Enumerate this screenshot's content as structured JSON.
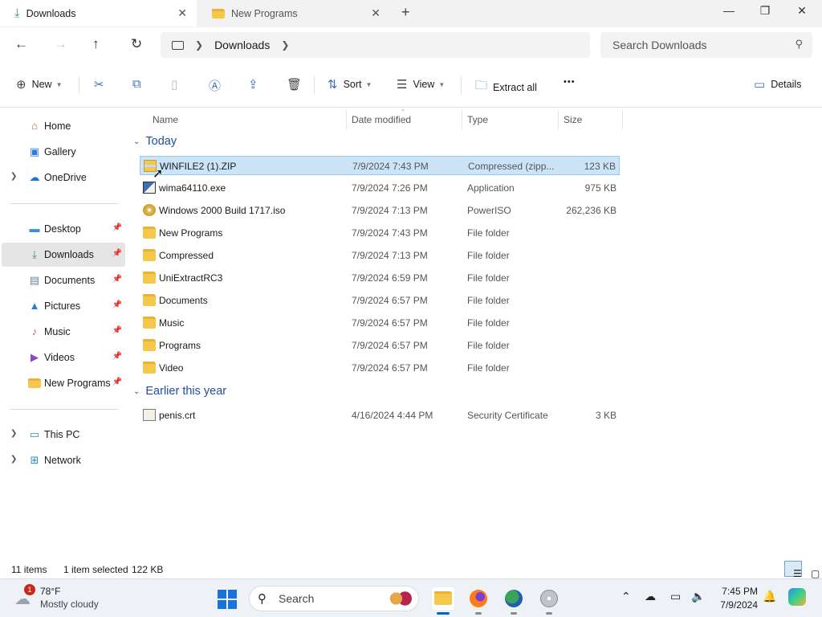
{
  "tabs": [
    {
      "label": "Downloads",
      "active": true
    },
    {
      "label": "New Programs",
      "active": false
    }
  ],
  "window_controls": {
    "minimize": "—",
    "maximize": "❐",
    "close": "✕",
    "new_tab": "+"
  },
  "address": {
    "segments": [
      "Downloads"
    ],
    "search_placeholder": "Search Downloads"
  },
  "commands": {
    "new": "New",
    "sort": "Sort",
    "view": "View",
    "extract_all": "Extract all",
    "more": "•••",
    "details": "Details"
  },
  "sidebar": {
    "top": [
      {
        "label": "Home",
        "icon": "home-icon",
        "expandable": false
      },
      {
        "label": "Gallery",
        "icon": "gallery-icon",
        "expandable": false
      },
      {
        "label": "OneDrive",
        "icon": "onedrive-icon",
        "expandable": true
      }
    ],
    "pinned": [
      {
        "label": "Desktop",
        "icon": "desktop-icon"
      },
      {
        "label": "Downloads",
        "icon": "downloads-icon",
        "selected": true
      },
      {
        "label": "Documents",
        "icon": "documents-icon"
      },
      {
        "label": "Pictures",
        "icon": "pictures-icon"
      },
      {
        "label": "Music",
        "icon": "music-icon"
      },
      {
        "label": "Videos",
        "icon": "videos-icon"
      },
      {
        "label": "New Programs",
        "icon": "folder-icon"
      }
    ],
    "bottom": [
      {
        "label": "This PC",
        "icon": "this-pc-icon"
      },
      {
        "label": "Network",
        "icon": "network-icon"
      }
    ]
  },
  "columns": {
    "name": "Name",
    "date": "Date modified",
    "type": "Type",
    "size": "Size"
  },
  "groups": [
    {
      "label": "Today",
      "files": [
        {
          "name": "WINFILE2 (1).ZIP",
          "date": "7/9/2024 7:43 PM",
          "type": "Compressed (zipp...",
          "size": "123 KB",
          "icon": "zip-icon",
          "selected": true
        },
        {
          "name": "wima64110.exe",
          "date": "7/9/2024 7:26 PM",
          "type": "Application",
          "size": "975 KB",
          "icon": "exe-icon"
        },
        {
          "name": "Windows 2000 Build 1717.iso",
          "date": "7/9/2024 7:13 PM",
          "type": "PowerISO",
          "size": "262,236 KB",
          "icon": "iso-icon"
        },
        {
          "name": "New Programs",
          "date": "7/9/2024 7:43 PM",
          "type": "File folder",
          "size": "",
          "icon": "folder-icon"
        },
        {
          "name": "Compressed",
          "date": "7/9/2024 7:13 PM",
          "type": "File folder",
          "size": "",
          "icon": "folder-icon"
        },
        {
          "name": "UniExtractRC3",
          "date": "7/9/2024 6:59 PM",
          "type": "File folder",
          "size": "",
          "icon": "folder-icon"
        },
        {
          "name": "Documents",
          "date": "7/9/2024 6:57 PM",
          "type": "File folder",
          "size": "",
          "icon": "folder-icon"
        },
        {
          "name": "Music",
          "date": "7/9/2024 6:57 PM",
          "type": "File folder",
          "size": "",
          "icon": "folder-icon"
        },
        {
          "name": "Programs",
          "date": "7/9/2024 6:57 PM",
          "type": "File folder",
          "size": "",
          "icon": "folder-icon"
        },
        {
          "name": "Video",
          "date": "7/9/2024 6:57 PM",
          "type": "File folder",
          "size": "",
          "icon": "folder-icon"
        }
      ]
    },
    {
      "label": "Earlier this year",
      "files": [
        {
          "name": "penis.crt",
          "date": "4/16/2024 4:44 PM",
          "type": "Security Certificate",
          "size": "3 KB",
          "icon": "certificate-icon"
        }
      ]
    }
  ],
  "status": {
    "items": "11 items",
    "selected": "1 item selected",
    "size": "122 KB"
  },
  "taskbar": {
    "weather_badge": "1",
    "temperature": "78°F",
    "condition": "Mostly cloudy",
    "search_label": "Search",
    "time": "7:45 PM",
    "date": "7/9/2024"
  },
  "colors": {
    "accent": "#0067c0",
    "selection": "#cce4f7",
    "group_header": "#1f4e9e",
    "folder": "#f5c84c"
  }
}
